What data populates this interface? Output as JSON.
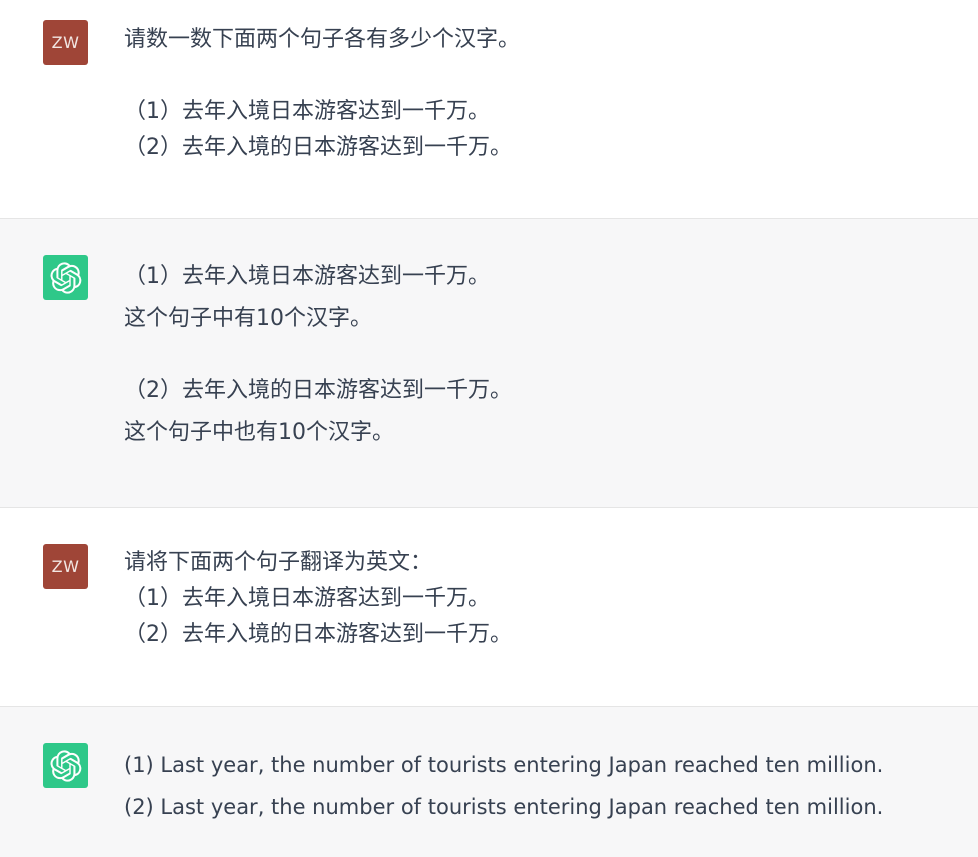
{
  "conversation": [
    {
      "role": "user",
      "avatar_text": "ZW",
      "lines": [
        "请数一数下面两个句子各有多少个汉字。",
        "",
        "（1）去年入境日本游客达到一千万。",
        "（2）去年入境的日本游客达到一千万。"
      ]
    },
    {
      "role": "assistant",
      "avatar_icon": "openai-logo-icon",
      "lines": [
        "（1）去年入境日本游客达到一千万。",
        "这个句子中有10个汉字。",
        "",
        "（2）去年入境的日本游客达到一千万。",
        "这个句子中也有10个汉字。"
      ]
    },
    {
      "role": "user",
      "avatar_text": "ZW",
      "lines": [
        "请将下面两个句子翻译为英文：",
        "（1）去年入境日本游客达到一千万。",
        "（2）去年入境的日本游客达到一千万。"
      ]
    },
    {
      "role": "assistant",
      "avatar_icon": "openai-logo-icon",
      "lines": [
        "(1) Last year, the number of tourists entering Japan reached ten million.",
        "(2) Last year, the number of tourists entering Japan reached ten million."
      ]
    }
  ],
  "colors": {
    "user_avatar": "#9f4537",
    "assistant_avatar": "#19c37d",
    "assistant_bg": "#f7f7f8"
  }
}
